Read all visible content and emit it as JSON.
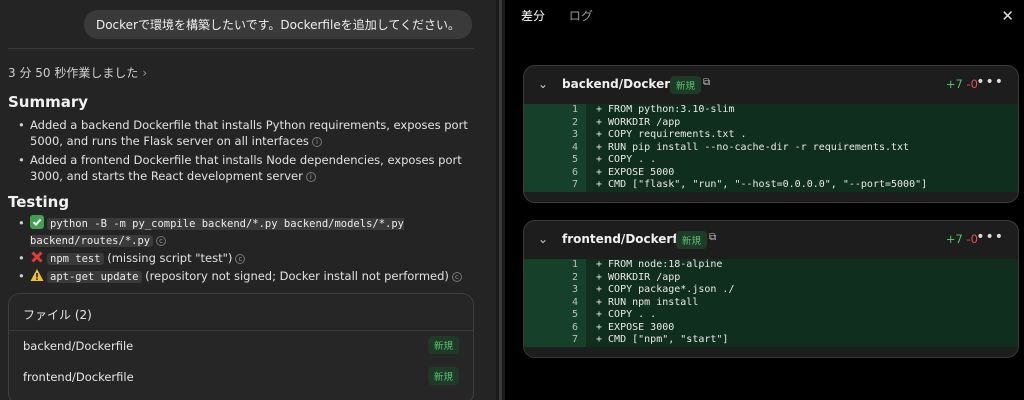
{
  "left": {
    "user_message": "Dockerで環境を構築したいです。Dockerfileを追加してください。",
    "worked_for": "3 分 50 秒作業しました",
    "summary_title": "Summary",
    "summary_items": [
      "Added a backend Dockerfile that installs Python requirements, exposes port 5000, and runs the Flask server on all interfaces",
      "Added a frontend Dockerfile that installs Node dependencies, exposes port 3000, and starts the React development server"
    ],
    "testing_title": "Testing",
    "testing_items": [
      {
        "status_icon": "check-icon",
        "command": "python -B -m py_compile backend/*.py backend/models/*.py backend/routes/*.py",
        "note": ""
      },
      {
        "status_icon": "cross-icon",
        "command": "npm test",
        "note": "(missing script \"test\")"
      },
      {
        "status_icon": "warning-icon",
        "command": "apt-get update",
        "note": "(repository not signed; Docker install not performed)"
      }
    ],
    "files_title": "ファイル (2)",
    "files": [
      {
        "name": "backend/Dockerfile",
        "badge": "新規"
      },
      {
        "name": "frontend/Dockerfile",
        "badge": "新規"
      }
    ]
  },
  "right": {
    "tabs": [
      "差分",
      "ログ"
    ],
    "active_tab": "差分",
    "diffs": [
      {
        "file": "backend/Dockerfile",
        "badge": "新規",
        "additions": "+7",
        "deletions": "-0",
        "lines": [
          "+ FROM python:3.10-slim",
          "+ WORKDIR /app",
          "+ COPY requirements.txt .",
          "+ RUN pip install --no-cache-dir -r requirements.txt",
          "+ COPY . .",
          "+ EXPOSE 5000",
          "+ CMD [\"flask\", \"run\", \"--host=0.0.0.0\", \"--port=5000\"]"
        ]
      },
      {
        "file": "frontend/Dockerfile",
        "badge": "新規",
        "additions": "+7",
        "deletions": "-0",
        "lines": [
          "+ FROM node:18-alpine",
          "+ WORKDIR /app",
          "+ COPY package*.json ./",
          "+ RUN npm install",
          "+ COPY . .",
          "+ EXPOSE 3000",
          "+ CMD [\"npm\", \"start\"]"
        ]
      }
    ]
  },
  "colors": {
    "badge_green": "#56c26f",
    "diff_add_bg": "#0f2e1e",
    "additions": "#4fc464",
    "deletions": "#e05252"
  }
}
